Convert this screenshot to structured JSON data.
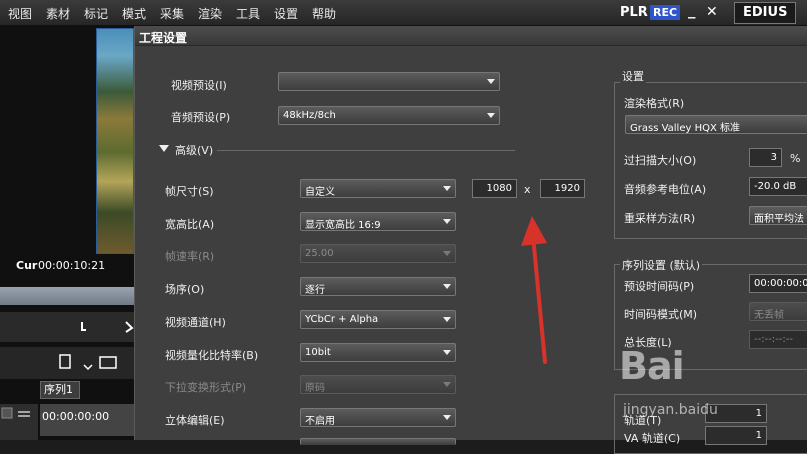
{
  "menubar": {
    "items": [
      "视图",
      "素材",
      "标记",
      "模式",
      "采集",
      "渲染",
      "工具",
      "设置",
      "帮助"
    ],
    "plr": "PLR",
    "rec": "REC",
    "minimize": "_",
    "close": "✕",
    "app": "EDIUS"
  },
  "left": {
    "cur_label": "Cur",
    "timecode": "00:00:10:21",
    "seq_tab": "序列1",
    "track_tc": "00:00:00:00"
  },
  "dialog": {
    "title": "工程设置",
    "video_preset_label": "视频预设(I)",
    "video_preset_value": "",
    "audio_preset_label": "音频预设(P)",
    "audio_preset_value": "48kHz/8ch",
    "advanced_label": "高级(V)",
    "frame_size_label": "帧尺寸(S)",
    "frame_size_value": "自定义",
    "frame_width": "1080",
    "frame_x": "x",
    "frame_height": "1920",
    "aspect_label": "宽高比(A)",
    "aspect_value": "显示宽高比 16:9",
    "fps_label": "帧速率(R)",
    "fps_value": "25.00",
    "field_order_label": "场序(O)",
    "field_order_value": "逐行",
    "video_channel_label": "视频通道(H)",
    "video_channel_value": "YCbCr + Alpha",
    "bit_depth_label": "视频量化比特率(B)",
    "bit_depth_value": "10bit",
    "pulldown_label": "下拉变换形式(P)",
    "pulldown_value": "原码",
    "stereo_label": "立体编辑(E)",
    "stereo_value": "不启用"
  },
  "settings": {
    "group_title": "设置",
    "render_format_label": "渲染格式(R)",
    "render_format_value": "Grass Valley HQX 标准",
    "overscan_label": "过扫描大小(O)",
    "overscan_value": "3",
    "overscan_unit": "%",
    "audio_ref_label": "音频参考电位(A)",
    "audio_ref_value": "-20.0 dB",
    "resample_label": "重采样方法(R)",
    "resample_value": "面积平均法"
  },
  "sequence": {
    "group_title": "序列设置 (默认)",
    "preset_tc_label": "预设时间码(P)",
    "preset_tc_value": "00:00:00:00",
    "tc_mode_label": "时间码模式(M)",
    "tc_mode_value": "无丢帧",
    "total_length_label": "总长度(L)",
    "total_length_value": "--:--:--:--",
    "track_label": "轨道(T)",
    "track_value": "1",
    "va_track_label": "VA 轨道(C)",
    "va_track_value": "1"
  },
  "watermark": {
    "text": "Bai",
    "url": "jingyan.baidu"
  }
}
